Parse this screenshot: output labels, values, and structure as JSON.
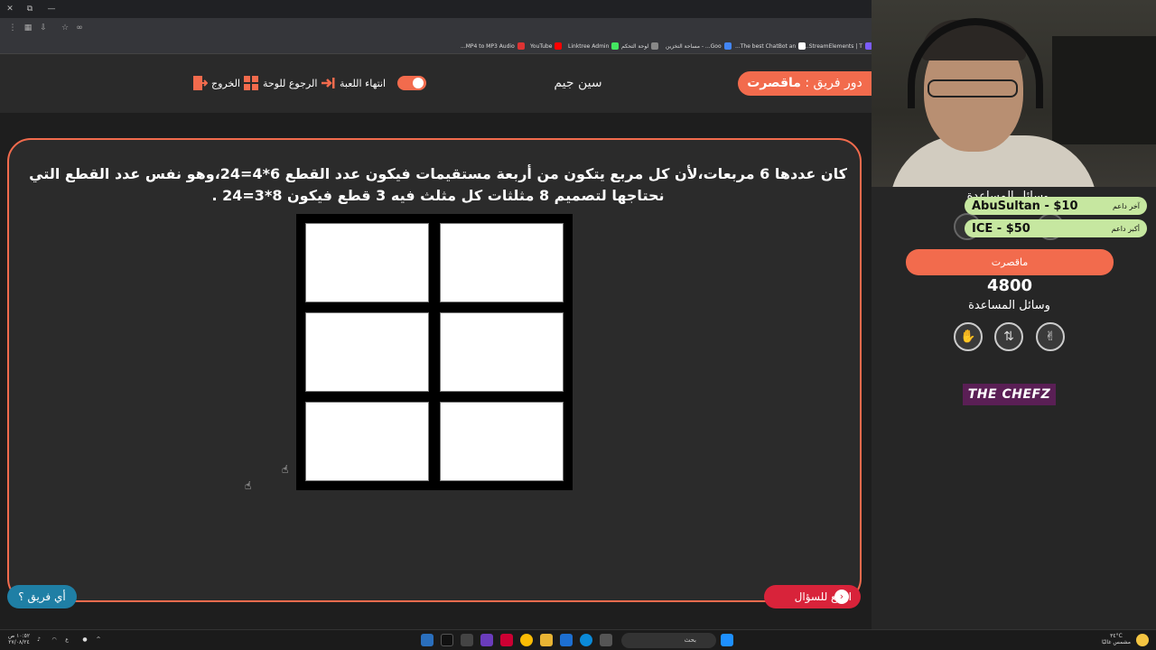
{
  "browser": {
    "bookmarks": [
      {
        "label": "MP4 to MP3 Audio...",
        "color": "#d33"
      },
      {
        "label": "YouTube",
        "color": "#f00"
      },
      {
        "label": "Linktree Admin",
        "color": "#43e660"
      },
      {
        "label": "لوحة التحكم",
        "color": "#888"
      },
      {
        "label": "Goo... - مساحة التخزين",
        "color": "#4285f4"
      },
      {
        "label": "The best ChatBot an...",
        "color": "#fff"
      },
      {
        "label": "StreamElements | T...",
        "color": "#7b5cff"
      }
    ]
  },
  "gamebar": {
    "team_turn_prefix": "دور فريق :",
    "team_turn_name": "ماقصرت",
    "game_name": "سين جيم",
    "end_game": "انتهاء اللعبة",
    "back_to_board": "الرجوع للوحة",
    "exit": "الخروج"
  },
  "question": {
    "text": "كان عددها 6 مربعات،لأن كل مربع يتكون من أربعة مستقيمات فيكون عدد القطع 6*4=24،وهو نفس عدد القطع التي نحتاجها لتصميم 8 مثلثات كل مثلث فيه 3 قطع فيكون 8*3=24 ."
  },
  "buttons": {
    "back_to_question": "ارجع للسؤال",
    "which_team": "أي فريق ؟"
  },
  "panel": {
    "helpers_title_top": "وسائل المساعدة",
    "last_donor_label": "آخر داعم",
    "last_donor_value": "AbuSultan - $10",
    "top_donor_label": "أكبر داعم",
    "top_donor_value": "ICE - $50",
    "team_name": "ماقصرت",
    "score": "4800",
    "helpers_label": "وسائل المساعدة",
    "helper_icons": [
      "hand-icon",
      "swap-icon",
      "two-fingers-icon"
    ],
    "sponsor": "THE CHEFZ"
  },
  "taskbar": {
    "time": "١٠:٥٢ ص",
    "date": "٢٧/٠٨/٢٤",
    "lang": "ع",
    "search_placeholder": "بحث",
    "weather_temp": "٣٤°C",
    "weather_text": "مشمس غالبًا"
  },
  "colors": {
    "accent": "#f26b4d",
    "back_button": "#d8233a",
    "which_button": "#1f7fa5",
    "donor_bg": "#c6e7a0",
    "sponsor_bg": "#5a1f55"
  }
}
